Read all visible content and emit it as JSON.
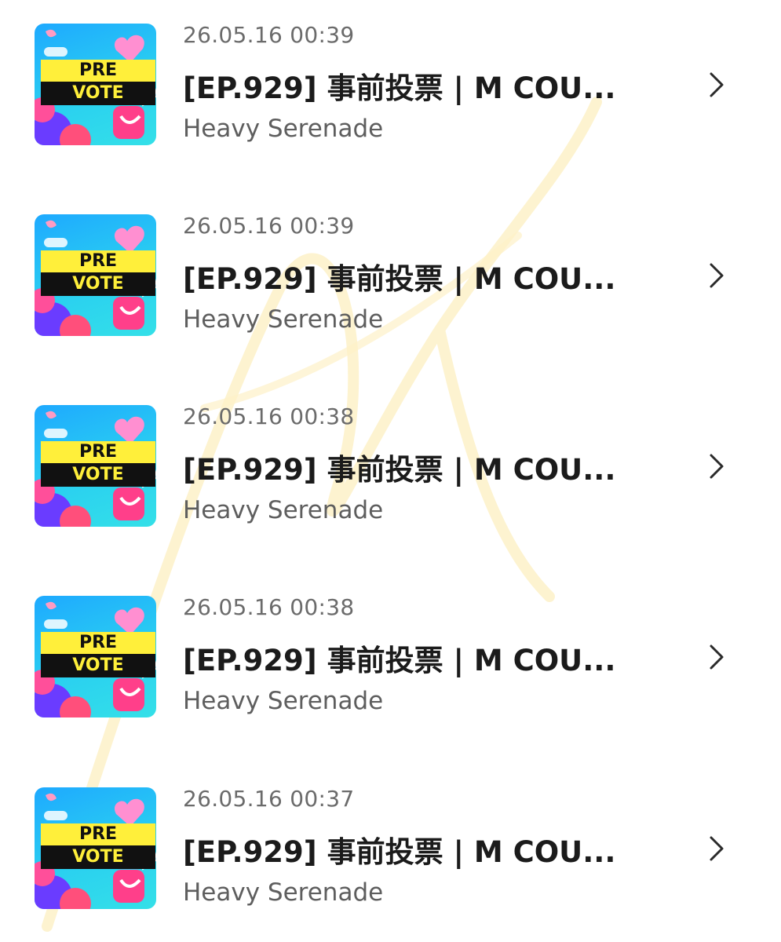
{
  "items": [
    {
      "timestamp": "26.05.16 00:39",
      "title": "[EP.929] 事前投票 | M COU...",
      "subtitle": "Heavy Serenade",
      "thumb_top": "PRE",
      "thumb_bottom": "VOTE"
    },
    {
      "timestamp": "26.05.16 00:39",
      "title": "[EP.929] 事前投票 | M COU...",
      "subtitle": "Heavy Serenade",
      "thumb_top": "PRE",
      "thumb_bottom": "VOTE"
    },
    {
      "timestamp": "26.05.16 00:38",
      "title": "[EP.929] 事前投票 | M COU...",
      "subtitle": "Heavy Serenade",
      "thumb_top": "PRE",
      "thumb_bottom": "VOTE"
    },
    {
      "timestamp": "26.05.16 00:38",
      "title": "[EP.929] 事前投票 | M COU...",
      "subtitle": "Heavy Serenade",
      "thumb_top": "PRE",
      "thumb_bottom": "VOTE"
    },
    {
      "timestamp": "26.05.16 00:37",
      "title": "[EP.929] 事前投票 | M COU...",
      "subtitle": "Heavy Serenade",
      "thumb_top": "PRE",
      "thumb_bottom": "VOTE"
    }
  ],
  "icons": {
    "chevron": "chevron-right-icon",
    "watermark": "signature-watermark"
  },
  "colors": {
    "banner_yellow": "#ffef3a",
    "banner_black": "#111111",
    "thumb_blue": "#1ea9ff",
    "watermark": "#fdf1c8"
  }
}
